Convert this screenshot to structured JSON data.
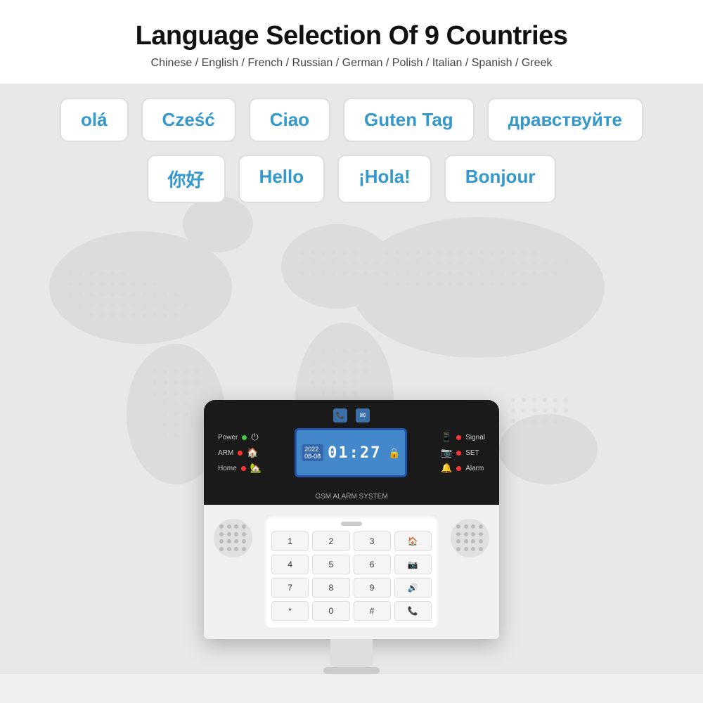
{
  "header": {
    "title": "Language Selection Of 9 Countries",
    "subtitle": "Chinese / English / French / Russian / German / Polish / Italian / Spanish / Greek"
  },
  "bubbles": {
    "row1": [
      {
        "text": "olá",
        "label": "portuguese-greeting"
      },
      {
        "text": "Cześć",
        "label": "polish-greeting"
      },
      {
        "text": "Ciao",
        "label": "italian-greeting"
      },
      {
        "text": "Guten Tag",
        "label": "german-greeting"
      },
      {
        "text": "дравствуйте",
        "label": "russian-greeting"
      }
    ],
    "row2": [
      {
        "text": "你好",
        "label": "chinese-greeting"
      },
      {
        "text": "Hello",
        "label": "english-greeting"
      },
      {
        "text": "¡Hola!",
        "label": "spanish-greeting"
      },
      {
        "text": "Bonjour",
        "label": "french-greeting"
      }
    ]
  },
  "device": {
    "brand": "GSM ALARM SYSTEM",
    "left_indicators": [
      {
        "label": "Power",
        "dot_color": "green",
        "icon": "⏻"
      },
      {
        "label": "ARM",
        "dot_color": "red",
        "icon": "🏠"
      },
      {
        "label": "Home",
        "dot_color": "red",
        "icon": "🏡"
      }
    ],
    "right_indicators": [
      {
        "label": "Signal",
        "dot_color": "red",
        "icon": "📱"
      },
      {
        "label": "SET",
        "dot_color": "red",
        "icon": "📷"
      },
      {
        "label": "Alarm",
        "dot_color": "red",
        "icon": "🔔"
      }
    ],
    "lcd": {
      "date": "2022\n08-08",
      "time": "01:27",
      "lock_icon": "🔒"
    },
    "keypad": {
      "keys": [
        "1",
        "2",
        "3",
        "🏠",
        "4",
        "5",
        "6",
        "📷",
        "7",
        "8",
        "9",
        "🔊",
        "*",
        "0",
        "#",
        "📞"
      ]
    }
  }
}
